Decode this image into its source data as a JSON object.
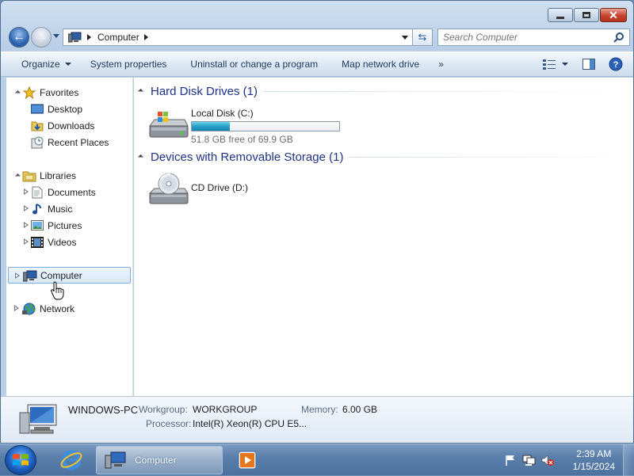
{
  "window": {
    "minimize_label": "Minimize",
    "maximize_label": "Maximize",
    "close_label": "Close"
  },
  "navbar": {
    "breadcrumb": [
      "Computer"
    ],
    "search_placeholder": "Search Computer"
  },
  "toolbar": {
    "organize": "Organize",
    "system_properties": "System properties",
    "uninstall": "Uninstall or change a program",
    "map_drive": "Map network drive",
    "more": "»"
  },
  "sidebar": {
    "favorites": {
      "label": "Favorites",
      "items": [
        "Desktop",
        "Downloads",
        "Recent Places"
      ]
    },
    "libraries": {
      "label": "Libraries",
      "items": [
        "Documents",
        "Music",
        "Pictures",
        "Videos"
      ]
    },
    "computer": {
      "label": "Computer",
      "selected": true
    },
    "network": {
      "label": "Network"
    }
  },
  "content": {
    "groups": [
      {
        "title": "Hard Disk Drives (1)",
        "items": [
          {
            "name": "Local Disk (C:)",
            "free_text": "51.8 GB free of 69.9 GB",
            "used_fraction": 0.259
          }
        ]
      },
      {
        "title": "Devices with Removable Storage (1)",
        "items": [
          {
            "name": "CD Drive (D:)"
          }
        ]
      }
    ]
  },
  "details": {
    "computer_name": "WINDOWS-PC",
    "workgroup_label": "Workgroup:",
    "workgroup_value": "WORKGROUP",
    "memory_label": "Memory:",
    "memory_value": "6.00 GB",
    "processor_label": "Processor:",
    "processor_value": "Intel(R) Xeon(R) CPU E5..."
  },
  "taskbar": {
    "active_window": "Computer",
    "time": "2:39 AM",
    "date": "1/15/2024"
  },
  "colors": {
    "accent": "#1e3287",
    "selection": "#d7e8fb",
    "progress": "#26a0c6"
  }
}
